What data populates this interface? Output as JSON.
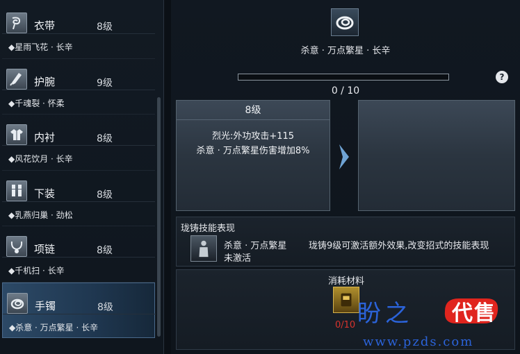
{
  "sidebar": {
    "items": [
      {
        "name": "衣带",
        "level": "8级",
        "set": "◆星雨飞花 · 长辛",
        "icon": "belt-icon"
      },
      {
        "name": "护腕",
        "level": "9级",
        "set": "◆千魂裂 · 怀柔",
        "icon": "bracer-icon"
      },
      {
        "name": "内衬",
        "level": "8级",
        "set": "◆风花饮月 · 长辛",
        "icon": "inner-shirt-icon"
      },
      {
        "name": "下装",
        "level": "8级",
        "set": "◆乳燕归巢 · 劲松",
        "icon": "pants-icon"
      },
      {
        "name": "项链",
        "level": "8级",
        "set": "◆千机扫 · 长辛",
        "icon": "necklace-icon"
      },
      {
        "name": "手镯",
        "level": "8级",
        "set": "◆杀意 · 万点繁星 · 长辛",
        "icon": "bracelet-icon"
      }
    ],
    "active_index": 5
  },
  "panel": {
    "skill_title": "杀意 · 万点繁星 · 长辛",
    "progress_text": "0 / 10",
    "progress_fraction": 0,
    "help_label": "?",
    "current": {
      "level": "8级",
      "line1": "烈光:外功攻击+115",
      "line2": "杀意 · 万点繁星伤害增加8%"
    },
    "effect_section": {
      "label": "珑铸技能表现",
      "skill_name": "杀意 · 万点繁星",
      "skill_state": "未激活",
      "description": "珑铸9级可激活额外效果,改变招式的技能表现"
    },
    "materials": {
      "label": "消耗材料",
      "count": "0/10"
    }
  },
  "watermark": {
    "text1": "盼之",
    "badge": "代售",
    "url": "www.pzds.com"
  },
  "colors": {
    "accent_blue": "#5d8fbf",
    "active_slot": "#2c4966",
    "insufficient_red": "#d8332d",
    "watermark_blue": "#2b63d9",
    "watermark_red": "#e0251e"
  }
}
